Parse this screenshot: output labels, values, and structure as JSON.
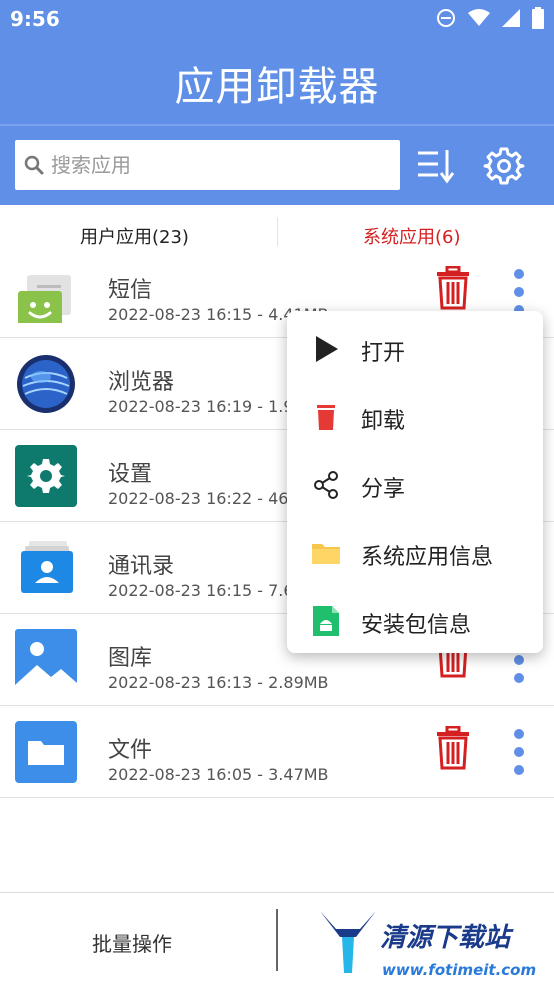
{
  "status_bar": {
    "time": "9:56"
  },
  "header": {
    "title": "应用卸载器"
  },
  "search": {
    "placeholder": "搜索应用"
  },
  "tabs": {
    "user_apps": "用户应用(23)",
    "system_apps": "系统应用(6)"
  },
  "apps": [
    {
      "name": "短信",
      "meta": "2022-08-23 16:15 - 4.41MB"
    },
    {
      "name": "浏览器",
      "meta": "2022-08-23 16:19 - 1.9"
    },
    {
      "name": "设置",
      "meta": "2022-08-23 16:22 - 46"
    },
    {
      "name": "通讯录",
      "meta": "2022-08-23 16:15 - 7.6"
    },
    {
      "name": "图库",
      "meta": "2022-08-23 16:13 - 2.89MB"
    },
    {
      "name": "文件",
      "meta": "2022-08-23 16:05 - 3.47MB"
    }
  ],
  "context_menu": {
    "items": [
      {
        "label": "打开",
        "icon": "play-icon"
      },
      {
        "label": "卸载",
        "icon": "trash-icon"
      },
      {
        "label": "分享",
        "icon": "share-icon"
      },
      {
        "label": "系统应用信息",
        "icon": "folder-icon"
      },
      {
        "label": "安装包信息",
        "icon": "apk-file-icon"
      }
    ]
  },
  "bottom_bar": {
    "batch_label": "批量操作",
    "brand_name": "清源下载站",
    "brand_url": "www.fotimeit.com"
  },
  "colors": {
    "accent": "#5f8fe6",
    "system_tab": "#d42020",
    "trash": "#d42020"
  }
}
